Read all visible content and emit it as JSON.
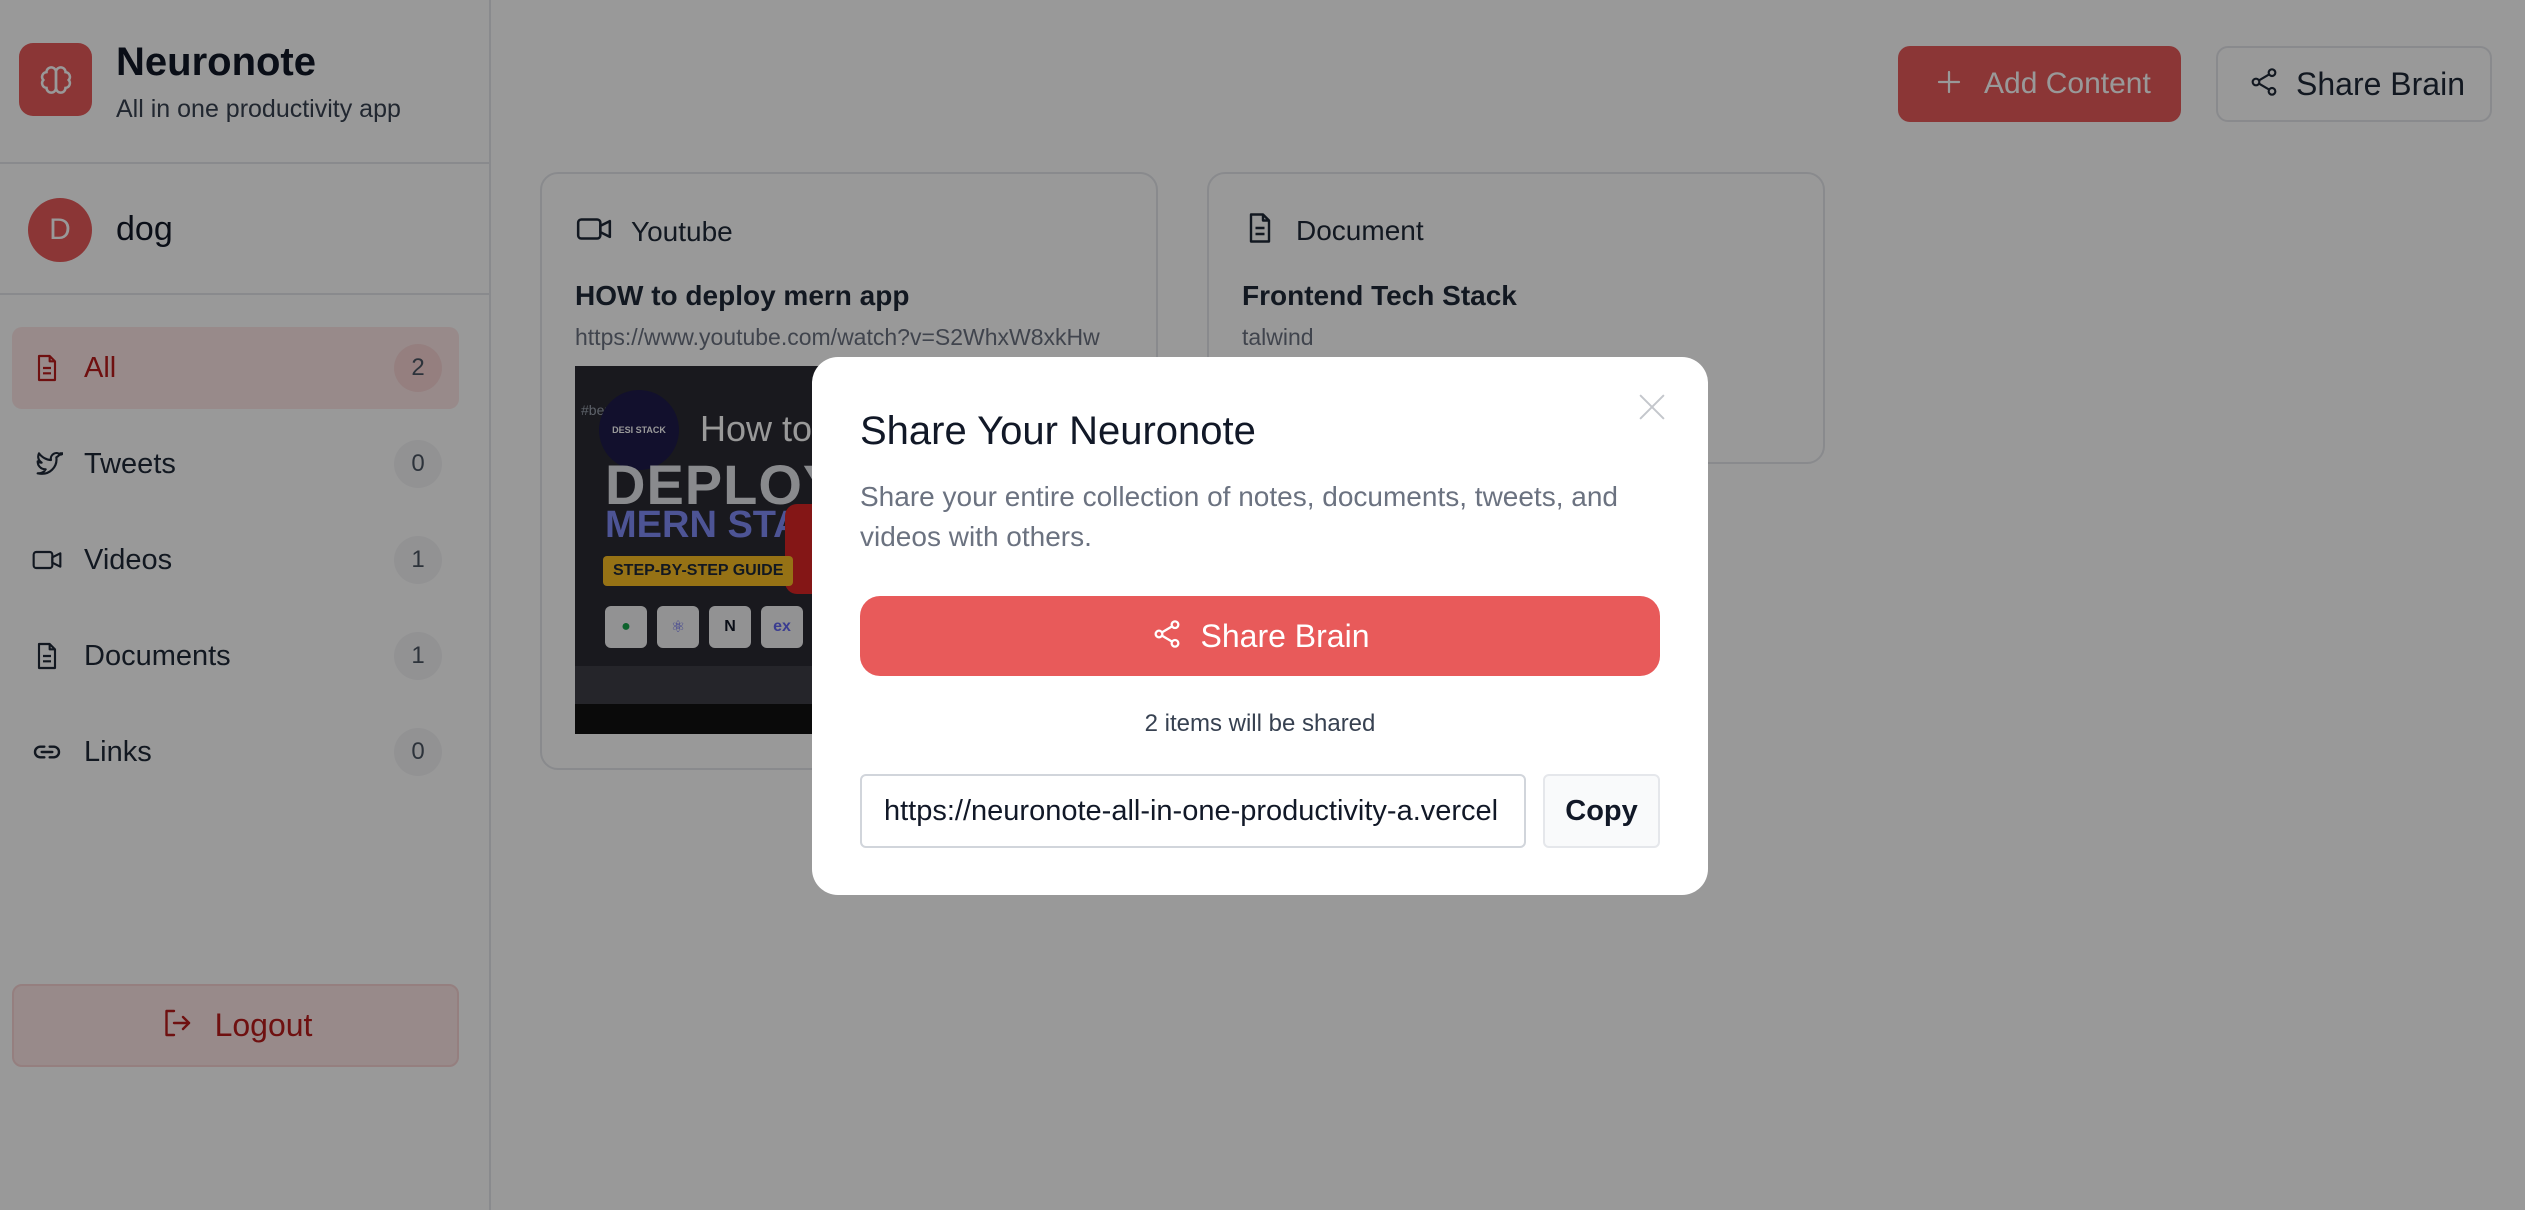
{
  "brand": {
    "title": "Neuronote",
    "subtitle": "All in one productivity app"
  },
  "user": {
    "initial": "D",
    "name": "dog"
  },
  "nav": [
    {
      "label": "All",
      "count": "2",
      "icon": "document-icon",
      "active": true
    },
    {
      "label": "Tweets",
      "count": "0",
      "icon": "twitter-icon"
    },
    {
      "label": "Videos",
      "count": "1",
      "icon": "video-icon"
    },
    {
      "label": "Documents",
      "count": "1",
      "icon": "document-icon"
    },
    {
      "label": "Links",
      "count": "0",
      "icon": "link-icon"
    }
  ],
  "logout_label": "Logout",
  "header": {
    "add_label": "Add Content",
    "share_label": "Share Brain"
  },
  "cards": [
    {
      "type": "Youtube",
      "title": "HOW to deploy mern app",
      "url": "https://www.youtube.com/watch?v=S2WhxW8xkHw",
      "thumbnail": {
        "tag": "#ber",
        "logo_text": "DESI STACK",
        "line1": "How to",
        "line2": "DEPLOY",
        "line3": "MERN STAC",
        "guide": "STEP-BY-STEP GUIDE",
        "chips": [
          "N",
          "ex"
        ]
      }
    },
    {
      "type": "Document",
      "title": "Frontend Tech Stack",
      "subtitle": "talwind"
    }
  ],
  "modal": {
    "title": "Share Your Neuronote",
    "description": "Share your entire collection of notes, documents, tweets, and videos with others.",
    "share_label": "Share Brain",
    "count_text": "2 items will be shared",
    "link_value": "https://neuronote-all-in-one-productivity-a.vercel",
    "copy_label": "Copy"
  },
  "colors": {
    "accent": "#e85a5a",
    "accent_dark": "#b91c1c",
    "accent_soft": "#fde7e7"
  }
}
